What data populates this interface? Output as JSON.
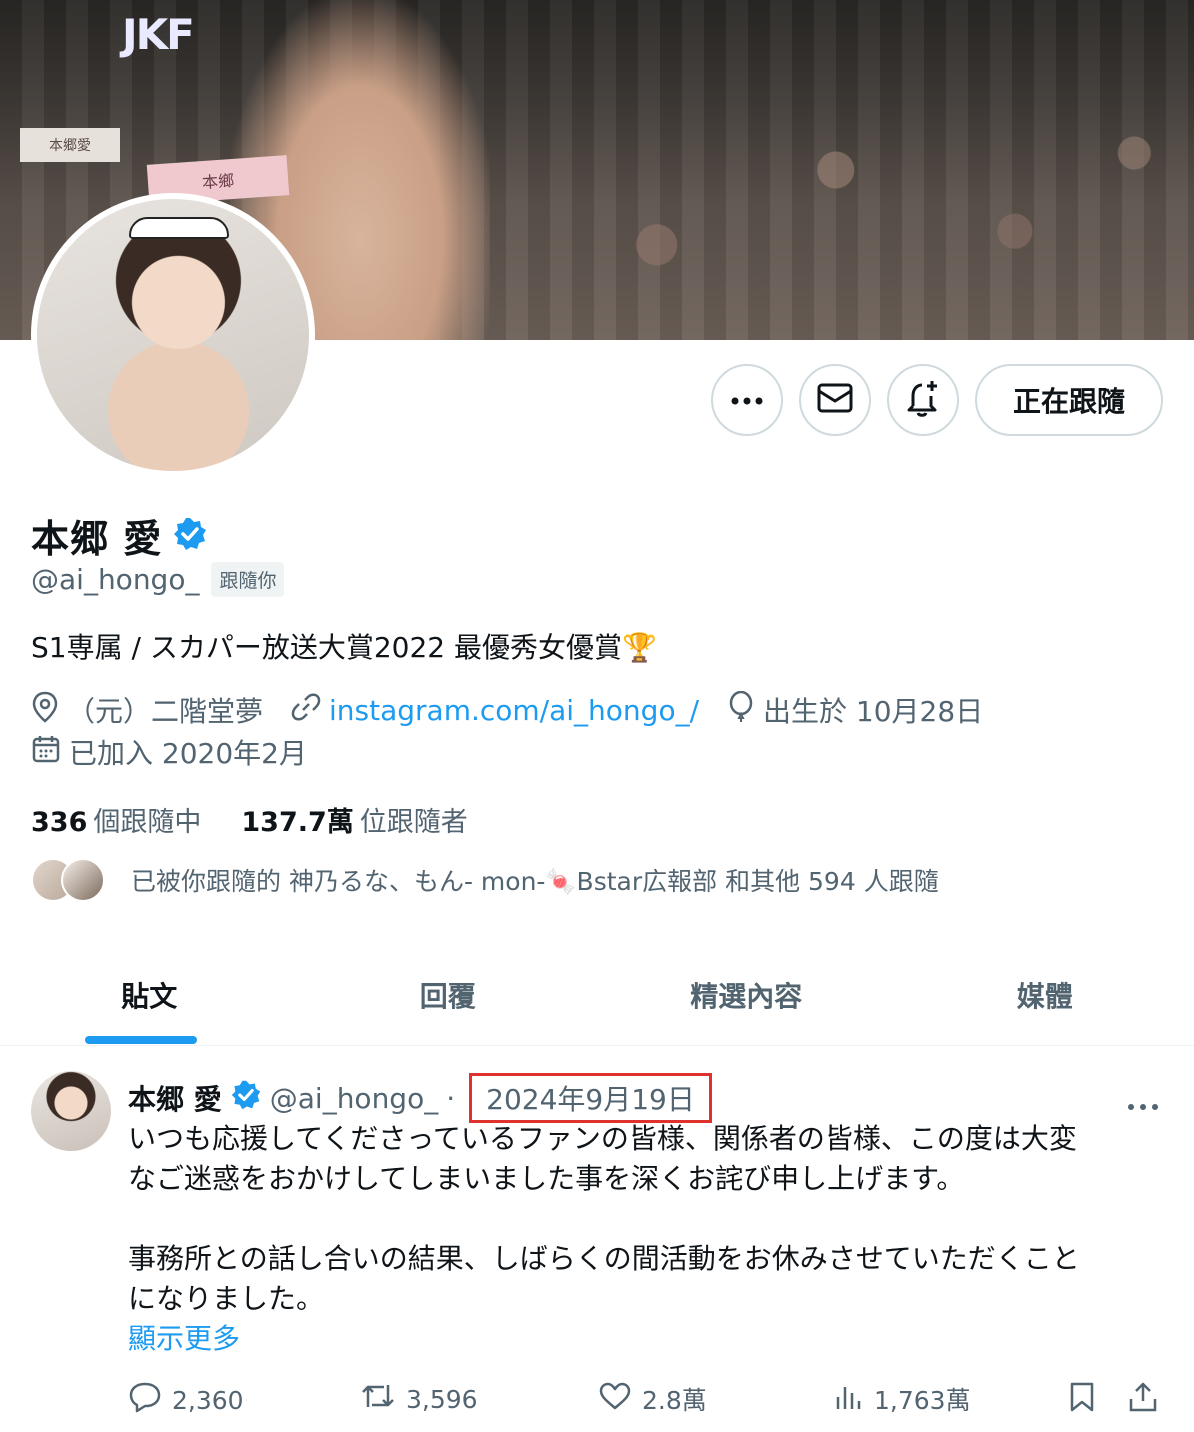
{
  "banner": {
    "logo": "JKF",
    "sign_left": "本郷愛",
    "sign_mid": "本鄉"
  },
  "actions": {
    "more_icon": "more-horizontal-icon",
    "message_icon": "mail-icon",
    "notify_icon": "bell-plus-icon",
    "follow_label": "正在跟隨"
  },
  "profile": {
    "name": "本郷 愛",
    "verified_icon": "verified-badge-icon",
    "handle": "@ai_hongo_",
    "follows_you": "跟隨你",
    "bio": "S1専属 / スカパー放送大賞2022 最優秀女優賞🏆",
    "location": "（元）二階堂夢",
    "link": "instagram.com/ai_hongo_/",
    "birthday": "出生於 10月28日",
    "joined": "已加入 2020年2月",
    "following_count": "336",
    "following_label": "個跟隨中",
    "followers_count": "137.7萬",
    "followers_label": "位跟隨者",
    "followed_by": "已被你跟隨的 神乃るな、もん- mon-🍬Bstar広報部 和其他 594 人跟隨"
  },
  "tabs": [
    {
      "label": "貼文"
    },
    {
      "label": "回覆"
    },
    {
      "label": "精選內容"
    },
    {
      "label": "媒體"
    }
  ],
  "post": {
    "name": "本郷 愛",
    "handle": "@ai_hongo_",
    "separator": "·",
    "date": "2024年9月19日",
    "line1": "いつも応援してくださっているファンの皆様、関係者の皆様、この度は大変",
    "line2": "なご迷惑をおかけしてしまいました事を深くお詫び申し上げます。",
    "line3": "事務所との話し合いの結果、しばらくの間活動をお休みさせていただくこと",
    "line4": "になりました。",
    "show_more": "顯示更多",
    "replies": "2,360",
    "reposts": "3,596",
    "likes": "2.8萬",
    "views": "1,763萬"
  },
  "colors": {
    "accent": "#1d9bf0",
    "text_primary": "#0f1419",
    "text_secondary": "#536471",
    "highlight_box": "#e0322c"
  }
}
